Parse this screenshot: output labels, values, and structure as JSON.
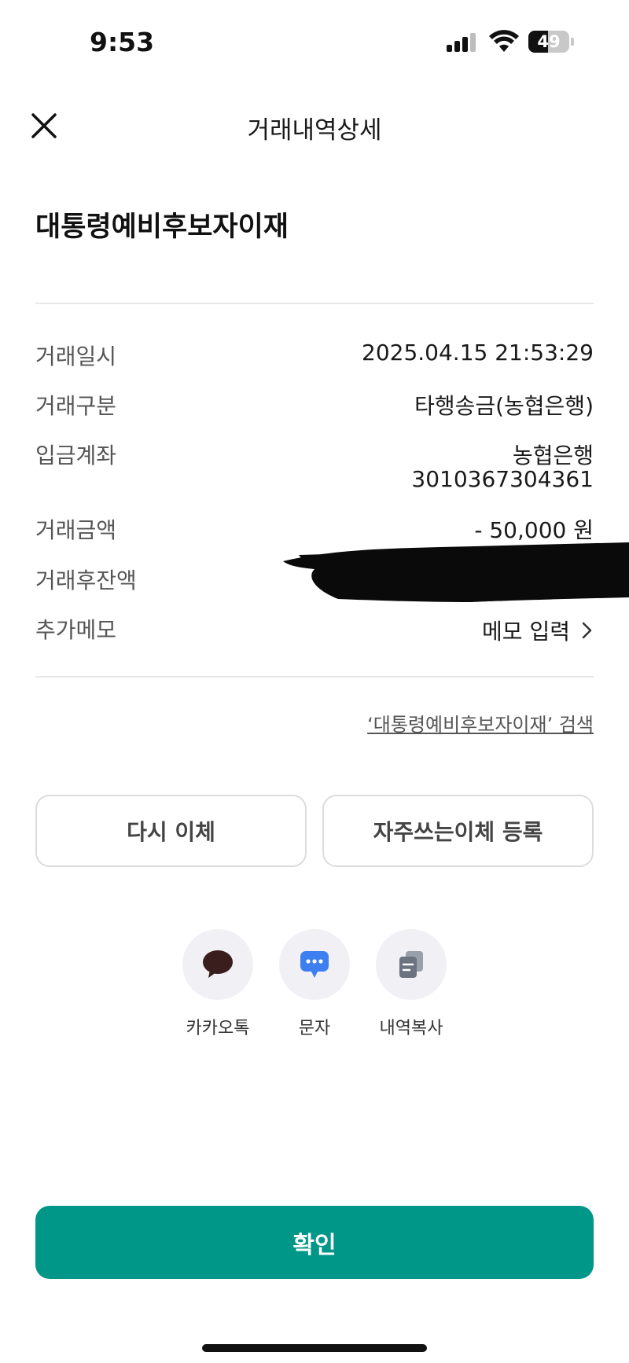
{
  "status_bar": {
    "time": "9:53",
    "battery": "49",
    "battery_level": 0.49
  },
  "header": {
    "title": "거래내역상세",
    "close_icon": "close-icon"
  },
  "transaction": {
    "title": "대통령예비후보자이재"
  },
  "details": {
    "datetime_label": "거래일시",
    "datetime_value": "2025.04.15 21:53:29",
    "type_label": "거래구분",
    "type_value": "타행송금(농협은행)",
    "account_label": "입금계좌",
    "account_bank": "농협은행",
    "account_number": "3010367304361",
    "amount_label": "거래금액",
    "amount_value": "- 50,000 원",
    "balance_label": "거래후잔액",
    "memo_label": "추가메모",
    "memo_action": "메모 입력"
  },
  "search_link": "‘대통령예비후보자이재’ 검색",
  "buttons": {
    "retransfer": "다시 이체",
    "register_frequent": "자주쓰는이체 등록",
    "confirm": "확인"
  },
  "share": [
    {
      "label": "카카오톡",
      "icon": "kakaotalk-icon"
    },
    {
      "label": "문자",
      "icon": "message-icon"
    },
    {
      "label": "내역복사",
      "icon": "copy-icon"
    }
  ],
  "colors": {
    "accent": "#009688",
    "message_icon": "#3d7ef0",
    "kakao_icon": "#3a1d1d",
    "copy_icon": "#6b7280"
  }
}
